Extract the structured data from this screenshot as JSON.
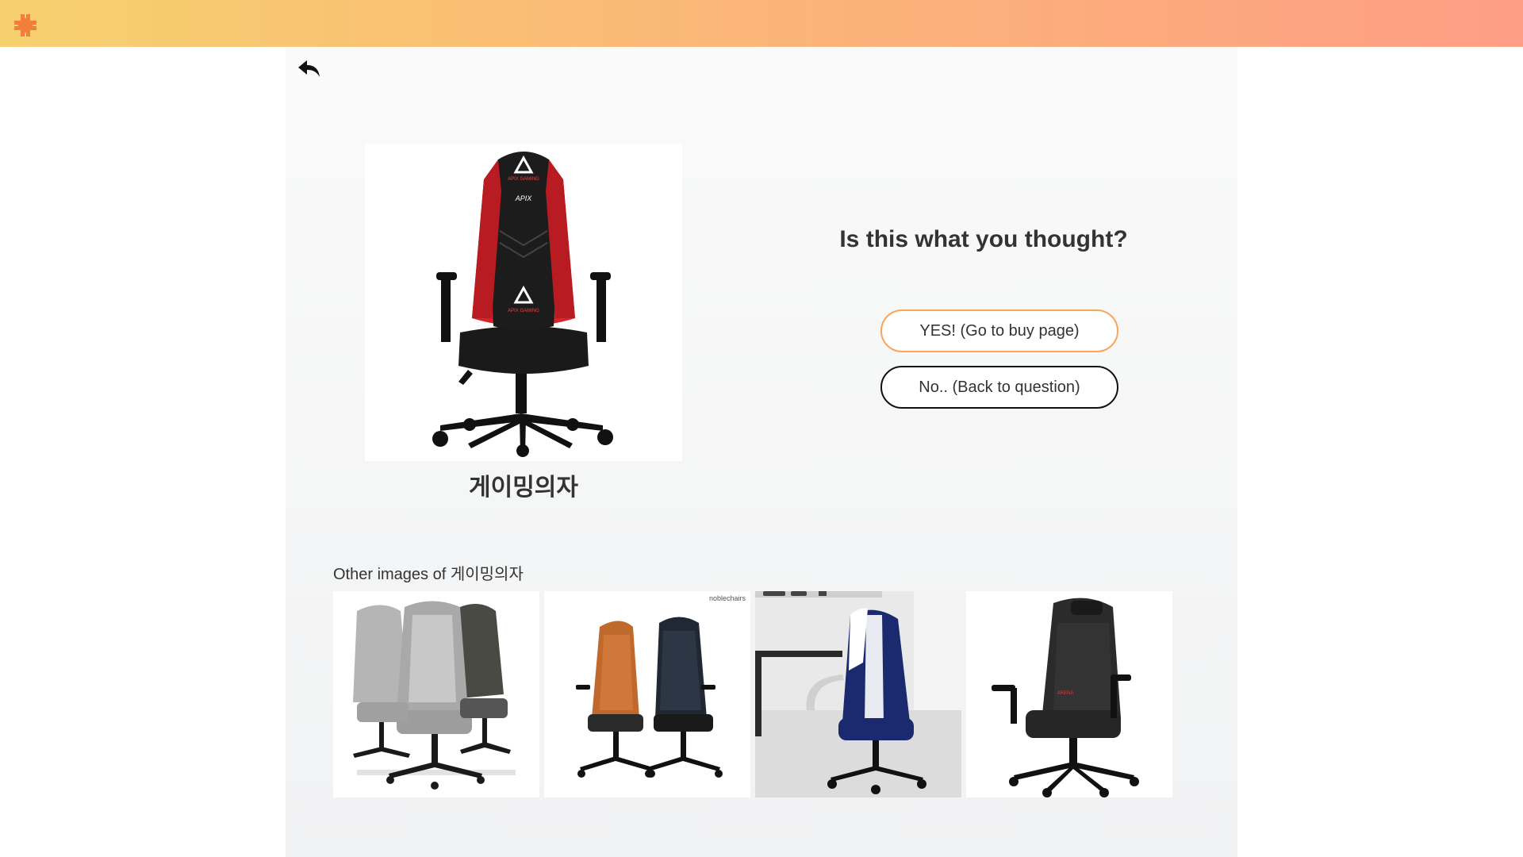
{
  "header": {
    "logo_icon": "puzzle-logo-icon",
    "gradient": [
      "#f7d06e",
      "#fd9e84"
    ]
  },
  "nav": {
    "back_icon": "back-arrow-icon"
  },
  "product": {
    "name": "게이밍의자",
    "image_icon": "gaming-chair-image",
    "brand_top": "APIX GAMING",
    "brand_mid": "APIX"
  },
  "confirm": {
    "question": "Is this what you thought?",
    "yes_label": "YES! (Go to buy page)",
    "no_label": "No.. (Back to question)"
  },
  "gallery": {
    "label_prefix": "Other images of ",
    "label_name": "게이밍의자",
    "images": [
      {
        "name": "gray-gaming-chairs-image"
      },
      {
        "name": "noblechairs-image",
        "watermark": "noblechairs"
      },
      {
        "name": "blue-gaming-chair-image"
      },
      {
        "name": "black-gaming-chair-image"
      }
    ]
  },
  "colors": {
    "yes_border": "#f8a55a",
    "no_border": "#111111",
    "chair_red": "#d9232a",
    "text": "#333333"
  }
}
